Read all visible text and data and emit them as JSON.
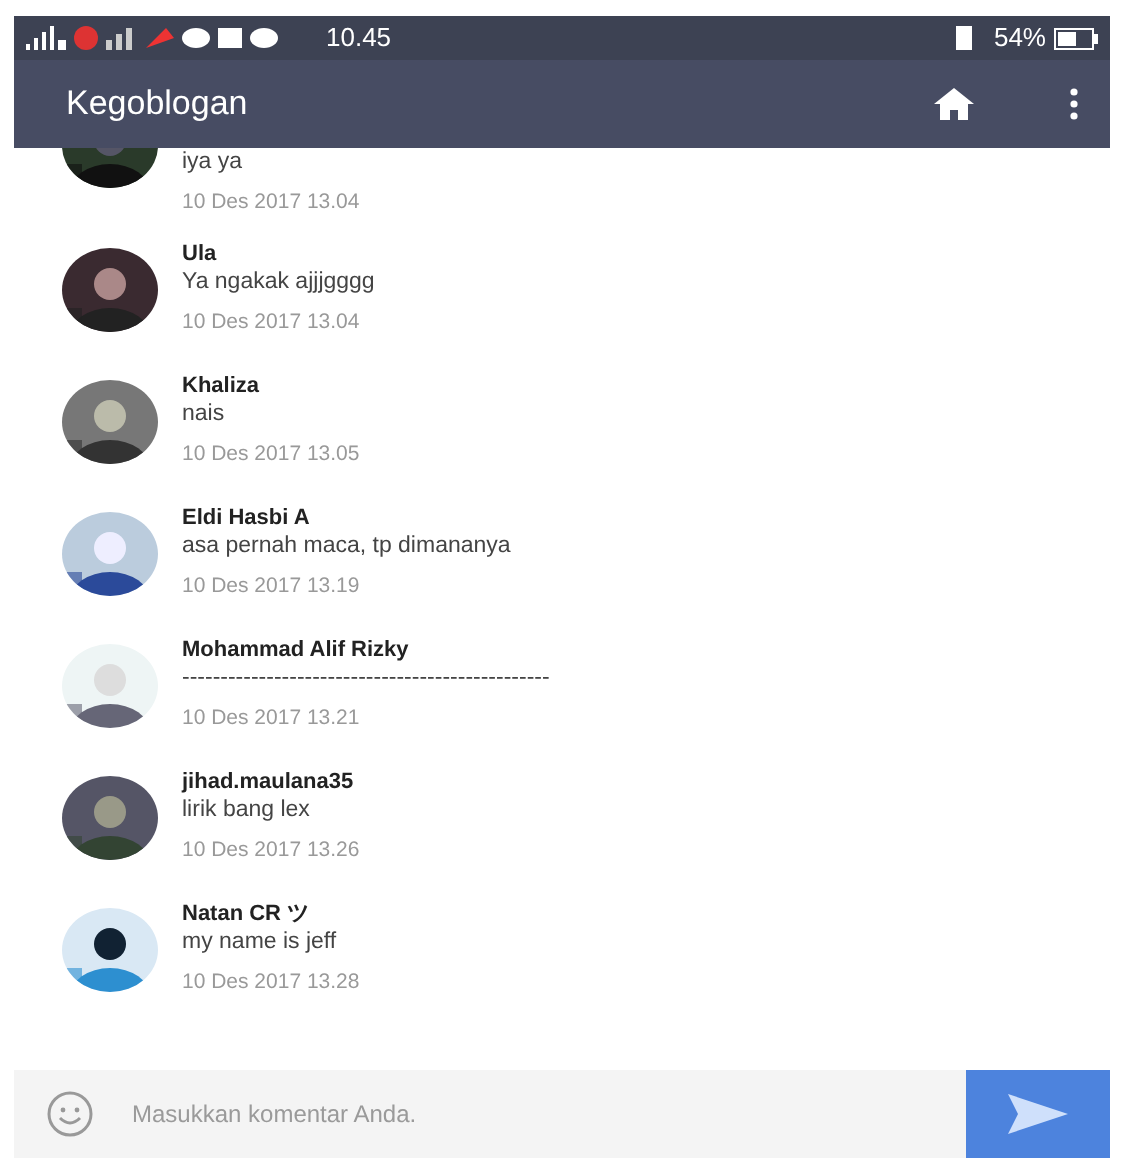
{
  "status_bar": {
    "time": "10.45",
    "battery": "54%"
  },
  "app_bar": {
    "title": "Kegoblogan"
  },
  "comments": [
    {
      "message": "iya ya",
      "date": "10 Des 2017 13.04"
    },
    {
      "name": "Ula",
      "message": "Ya ngakak ajjjgggg",
      "date": "10 Des 2017 13.04"
    },
    {
      "name": "Khaliza",
      "message": "nais",
      "date": "10 Des 2017 13.05"
    },
    {
      "name": "Eldi Hasbi A",
      "message": "asa pernah maca, tp dimananya",
      "date": "10 Des 2017 13.19"
    },
    {
      "name": "Mohammad Alif Rizky",
      "message": "------------------------------------------------",
      "date": "10 Des 2017 13.21"
    },
    {
      "name": "jihad.maulana35",
      "message": "lirik bang lex",
      "date": "10 Des 2017 13.26"
    },
    {
      "name": "Natan CR ツ",
      "message": "my name is jeff",
      "date": "10 Des 2017 13.28"
    }
  ],
  "composer": {
    "placeholder": "Masukkan komentar Anda."
  }
}
